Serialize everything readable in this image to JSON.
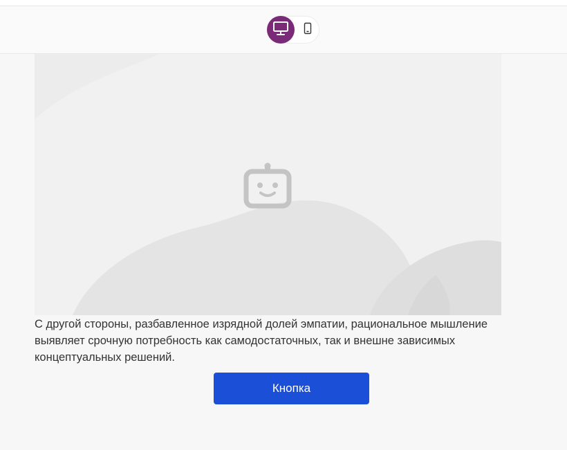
{
  "preview_toolbar": {
    "devices": [
      {
        "id": "desktop",
        "icon": "monitor-icon",
        "active": true
      },
      {
        "id": "mobile",
        "icon": "smartphone-icon",
        "active": false
      }
    ],
    "accent_color": "#7b2a78"
  },
  "content": {
    "image_placeholder_icon": "robot-face-icon",
    "paragraph": "С другой стороны, разбавленное изрядной долей эмпатии, рациональное мышление выявляет срочную потребность как самодостаточных, так и внешне зависимых концептуальных решений.",
    "button_label": "Кнопка",
    "button_color": "#1b4fd8"
  }
}
